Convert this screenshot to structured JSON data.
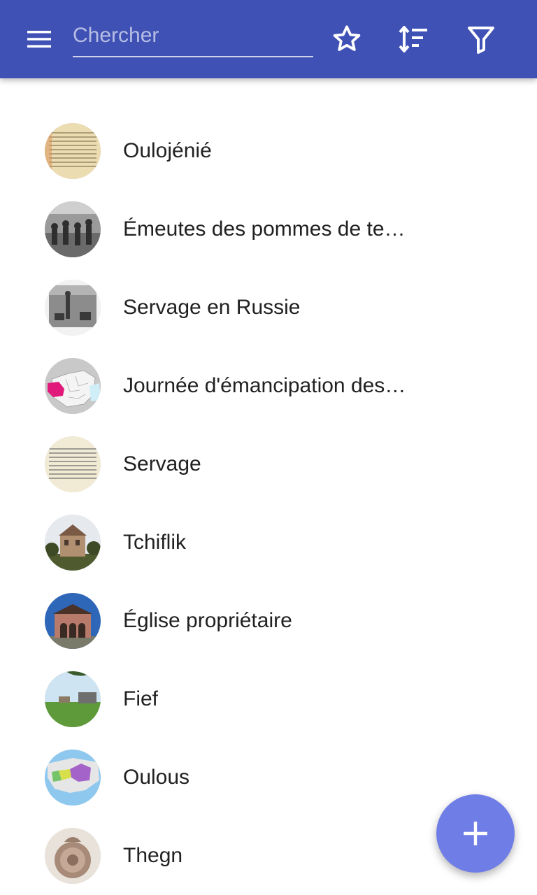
{
  "colors": {
    "app_bar": "#3f51b5",
    "fab": "#6f7de6",
    "text_primary": "#212121"
  },
  "app_bar": {
    "menu_icon": "menu-icon",
    "search_placeholder": "Chercher",
    "search_value": "",
    "actions": [
      {
        "icon": "star-outline-icon"
      },
      {
        "icon": "sort-icon"
      },
      {
        "icon": "filter-icon"
      }
    ]
  },
  "list": {
    "items": [
      {
        "label": "Oulojénié",
        "thumbnail": "old-printed-document"
      },
      {
        "label": "Émeutes des pommes de terre",
        "thumbnail": "crowd-engraving"
      },
      {
        "label": "Servage en Russie",
        "thumbnail": "serf-engraving"
      },
      {
        "label": "Journée d'émancipation des serfs",
        "thumbnail": "china-map-highlight"
      },
      {
        "label": "Servage",
        "thumbnail": "old-printed-text"
      },
      {
        "label": "Tchiflik",
        "thumbnail": "old-house"
      },
      {
        "label": "Église propriétaire",
        "thumbnail": "gatehouse-church"
      },
      {
        "label": "Fief",
        "thumbnail": "field-landscape"
      },
      {
        "label": "Oulous",
        "thumbnail": "mongol-empire-map"
      },
      {
        "label": "Thegn",
        "thumbnail": "bronze-seal"
      }
    ]
  },
  "fab": {
    "icon": "plus-icon"
  }
}
